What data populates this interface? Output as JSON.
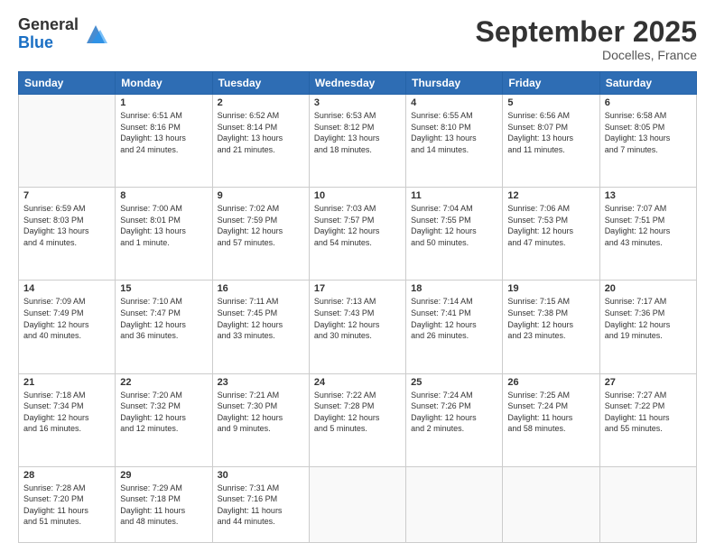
{
  "logo": {
    "general": "General",
    "blue": "Blue"
  },
  "header": {
    "month": "September 2025",
    "location": "Docelles, France"
  },
  "weekdays": [
    "Sunday",
    "Monday",
    "Tuesday",
    "Wednesday",
    "Thursday",
    "Friday",
    "Saturday"
  ],
  "weeks": [
    [
      {
        "day": "",
        "info": ""
      },
      {
        "day": "1",
        "info": "Sunrise: 6:51 AM\nSunset: 8:16 PM\nDaylight: 13 hours\nand 24 minutes."
      },
      {
        "day": "2",
        "info": "Sunrise: 6:52 AM\nSunset: 8:14 PM\nDaylight: 13 hours\nand 21 minutes."
      },
      {
        "day": "3",
        "info": "Sunrise: 6:53 AM\nSunset: 8:12 PM\nDaylight: 13 hours\nand 18 minutes."
      },
      {
        "day": "4",
        "info": "Sunrise: 6:55 AM\nSunset: 8:10 PM\nDaylight: 13 hours\nand 14 minutes."
      },
      {
        "day": "5",
        "info": "Sunrise: 6:56 AM\nSunset: 8:07 PM\nDaylight: 13 hours\nand 11 minutes."
      },
      {
        "day": "6",
        "info": "Sunrise: 6:58 AM\nSunset: 8:05 PM\nDaylight: 13 hours\nand 7 minutes."
      }
    ],
    [
      {
        "day": "7",
        "info": "Sunrise: 6:59 AM\nSunset: 8:03 PM\nDaylight: 13 hours\nand 4 minutes."
      },
      {
        "day": "8",
        "info": "Sunrise: 7:00 AM\nSunset: 8:01 PM\nDaylight: 13 hours\nand 1 minute."
      },
      {
        "day": "9",
        "info": "Sunrise: 7:02 AM\nSunset: 7:59 PM\nDaylight: 12 hours\nand 57 minutes."
      },
      {
        "day": "10",
        "info": "Sunrise: 7:03 AM\nSunset: 7:57 PM\nDaylight: 12 hours\nand 54 minutes."
      },
      {
        "day": "11",
        "info": "Sunrise: 7:04 AM\nSunset: 7:55 PM\nDaylight: 12 hours\nand 50 minutes."
      },
      {
        "day": "12",
        "info": "Sunrise: 7:06 AM\nSunset: 7:53 PM\nDaylight: 12 hours\nand 47 minutes."
      },
      {
        "day": "13",
        "info": "Sunrise: 7:07 AM\nSunset: 7:51 PM\nDaylight: 12 hours\nand 43 minutes."
      }
    ],
    [
      {
        "day": "14",
        "info": "Sunrise: 7:09 AM\nSunset: 7:49 PM\nDaylight: 12 hours\nand 40 minutes."
      },
      {
        "day": "15",
        "info": "Sunrise: 7:10 AM\nSunset: 7:47 PM\nDaylight: 12 hours\nand 36 minutes."
      },
      {
        "day": "16",
        "info": "Sunrise: 7:11 AM\nSunset: 7:45 PM\nDaylight: 12 hours\nand 33 minutes."
      },
      {
        "day": "17",
        "info": "Sunrise: 7:13 AM\nSunset: 7:43 PM\nDaylight: 12 hours\nand 30 minutes."
      },
      {
        "day": "18",
        "info": "Sunrise: 7:14 AM\nSunset: 7:41 PM\nDaylight: 12 hours\nand 26 minutes."
      },
      {
        "day": "19",
        "info": "Sunrise: 7:15 AM\nSunset: 7:38 PM\nDaylight: 12 hours\nand 23 minutes."
      },
      {
        "day": "20",
        "info": "Sunrise: 7:17 AM\nSunset: 7:36 PM\nDaylight: 12 hours\nand 19 minutes."
      }
    ],
    [
      {
        "day": "21",
        "info": "Sunrise: 7:18 AM\nSunset: 7:34 PM\nDaylight: 12 hours\nand 16 minutes."
      },
      {
        "day": "22",
        "info": "Sunrise: 7:20 AM\nSunset: 7:32 PM\nDaylight: 12 hours\nand 12 minutes."
      },
      {
        "day": "23",
        "info": "Sunrise: 7:21 AM\nSunset: 7:30 PM\nDaylight: 12 hours\nand 9 minutes."
      },
      {
        "day": "24",
        "info": "Sunrise: 7:22 AM\nSunset: 7:28 PM\nDaylight: 12 hours\nand 5 minutes."
      },
      {
        "day": "25",
        "info": "Sunrise: 7:24 AM\nSunset: 7:26 PM\nDaylight: 12 hours\nand 2 minutes."
      },
      {
        "day": "26",
        "info": "Sunrise: 7:25 AM\nSunset: 7:24 PM\nDaylight: 11 hours\nand 58 minutes."
      },
      {
        "day": "27",
        "info": "Sunrise: 7:27 AM\nSunset: 7:22 PM\nDaylight: 11 hours\nand 55 minutes."
      }
    ],
    [
      {
        "day": "28",
        "info": "Sunrise: 7:28 AM\nSunset: 7:20 PM\nDaylight: 11 hours\nand 51 minutes."
      },
      {
        "day": "29",
        "info": "Sunrise: 7:29 AM\nSunset: 7:18 PM\nDaylight: 11 hours\nand 48 minutes."
      },
      {
        "day": "30",
        "info": "Sunrise: 7:31 AM\nSunset: 7:16 PM\nDaylight: 11 hours\nand 44 minutes."
      },
      {
        "day": "",
        "info": ""
      },
      {
        "day": "",
        "info": ""
      },
      {
        "day": "",
        "info": ""
      },
      {
        "day": "",
        "info": ""
      }
    ]
  ]
}
